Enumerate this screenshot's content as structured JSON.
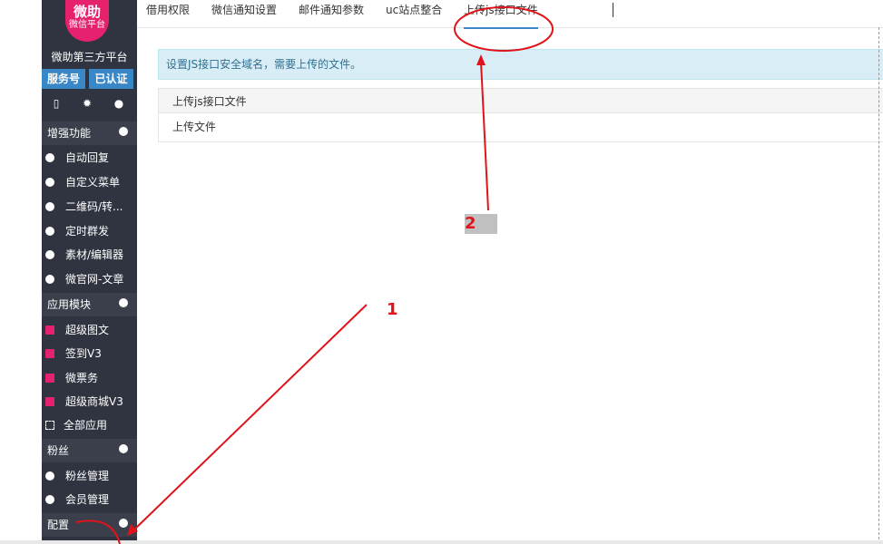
{
  "sidebar": {
    "logo_line1": "微助",
    "logo_line2": "微信平台",
    "platform_name": "微助第三方平台",
    "badge_service": "服务号",
    "badge_verified": "已认证",
    "icons": [
      "phone-icon",
      "gear-icon",
      "user-icon"
    ],
    "sections": {
      "enhance": "增强功能",
      "apps": "应用模块",
      "fans": "粉丝",
      "config": "配置"
    },
    "enhance_items": [
      "自动回复",
      "自定义菜单",
      "二维码/转...",
      "定时群发",
      "素材/编辑器",
      "微官网-文章"
    ],
    "app_items": [
      "超级图文",
      "签到V3",
      "微票务",
      "超级商城V3",
      "全部应用"
    ],
    "fan_items": [
      "粉丝管理",
      "会员管理"
    ]
  },
  "tabs": [
    "借用权限",
    "微信通知设置",
    "邮件通知参数",
    "uc站点整合",
    "上传js接口文件"
  ],
  "active_tab": "上传js接口文件",
  "alert_text": "设置JS接口安全域名，需要上传的文件。",
  "table": {
    "header": "上传js接口文件",
    "row": "上传文件"
  },
  "annotations": {
    "label1": "1",
    "label2": "2",
    "color": "#e0131b"
  },
  "colors": {
    "sidebar_bg": "#2f3440",
    "accent_blue": "#3a87c8",
    "brand_pink": "#e6226f",
    "alert_bg": "#d9edf7"
  }
}
